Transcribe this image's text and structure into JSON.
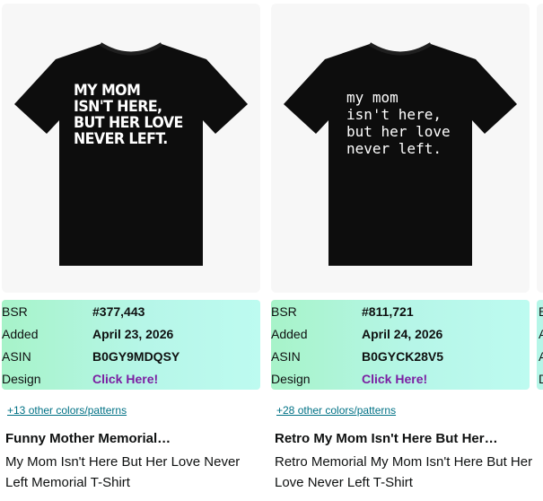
{
  "cards": [
    {
      "shirt_text": "MY MOM\nISN'T HERE,\nBUT HER LOVE\nNEVER LEFT.",
      "bsr_label": "BSR",
      "bsr": "#377,443",
      "added_label": "Added",
      "added": "April 23, 2026",
      "asin_label": "ASIN",
      "asin": "B0GY9MDQSY",
      "design_label": "Design",
      "design_link": "Click Here!",
      "colors_link": "+13 other colors/patterns",
      "title": "Funny Mother Memorial…",
      "description": "My Mom Isn't Here But Her Love Never Left Memorial T-Shirt"
    },
    {
      "shirt_text": "my mom\nisn't here,\nbut her love\nnever left.",
      "bsr_label": "BSR",
      "bsr": "#811,721",
      "added_label": "Added",
      "added": "April 24, 2026",
      "asin_label": "ASIN",
      "asin": "B0GYCK28V5",
      "design_label": "Design",
      "design_link": "Click Here!",
      "colors_link": "+28 other colors/patterns",
      "title": "Retro My Mom Isn't Here But Her…",
      "description": "Retro Memorial My Mom Isn't Here But Her Love Never Left T-Shirt"
    }
  ],
  "edge_card": {
    "letters": [
      "B",
      "A",
      "A",
      "D"
    ]
  },
  "colors": {
    "panel_start": "#a7f3c9",
    "panel_end": "#bdfbf0",
    "link": "#007185",
    "design_link": "#7b1fa2"
  }
}
